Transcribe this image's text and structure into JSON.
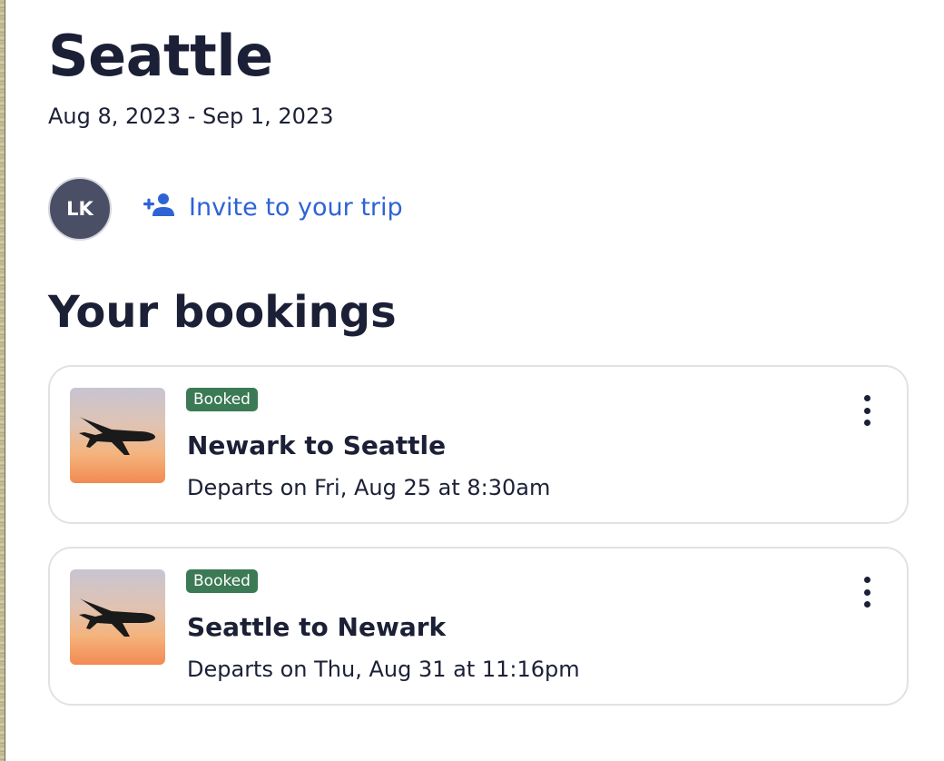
{
  "trip": {
    "title": "Seattle",
    "dates": "Aug 8, 2023 - Sep 1, 2023"
  },
  "traveler": {
    "initials": "LK"
  },
  "invite": {
    "label": "Invite to your trip",
    "icon": "add-person-icon"
  },
  "bookings": {
    "heading": "Your bookings",
    "items": [
      {
        "status": "Booked",
        "title": "Newark to Seattle",
        "subtitle": "Departs on Fri, Aug 25 at 8:30am",
        "image": "airplane-sunset-thumbnail"
      },
      {
        "status": "Booked",
        "title": "Seattle to Newark",
        "subtitle": "Departs on Thu, Aug 31 at 11:16pm",
        "image": "airplane-sunset-thumbnail"
      }
    ]
  },
  "colors": {
    "primary_text": "#1c2036",
    "link": "#2e63d6",
    "badge_bg": "#3c7a55",
    "avatar_bg": "#4b4f66",
    "card_border": "#e1e2e6"
  }
}
